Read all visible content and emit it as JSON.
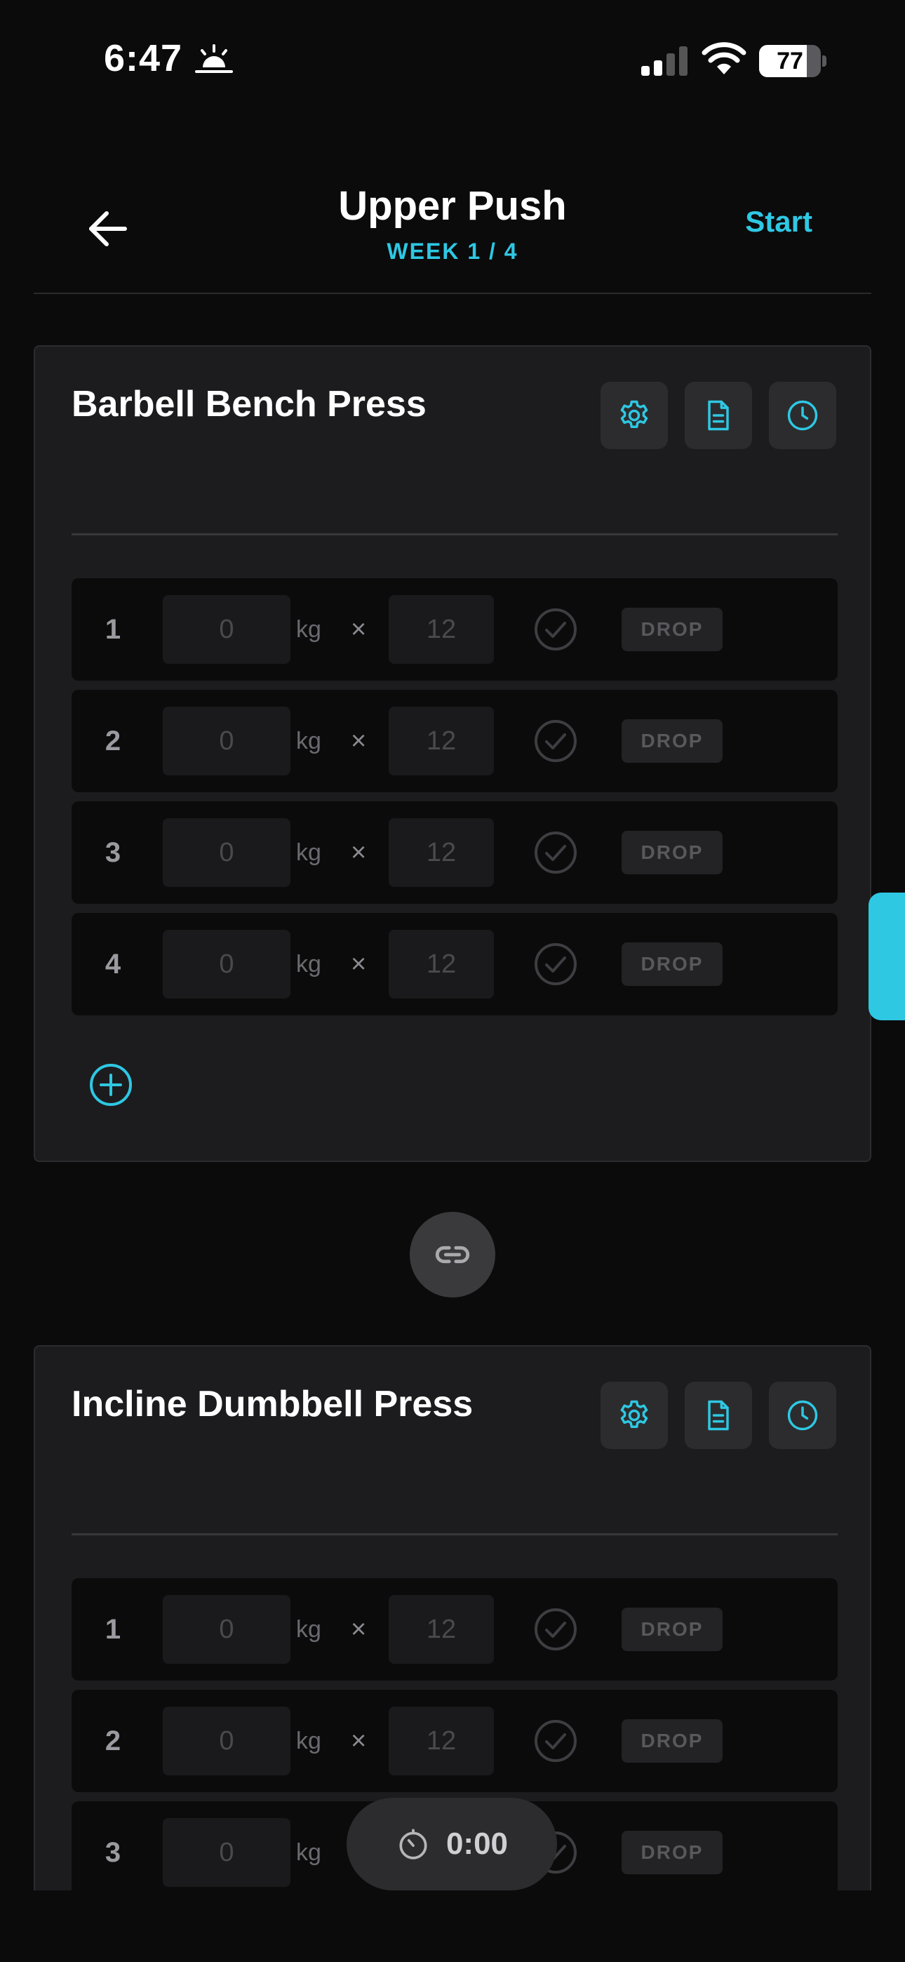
{
  "status_bar": {
    "time": "6:47",
    "battery_level": "77",
    "battery_fraction": 0.77
  },
  "header": {
    "title": "Upper Push",
    "subtitle": "WEEK 1 / 4",
    "start_label": "Start"
  },
  "exercises": [
    {
      "name": "Barbell Bench Press",
      "sets": [
        {
          "number": "1",
          "weight_placeholder": "0",
          "unit": "kg",
          "times": "×",
          "reps_placeholder": "12",
          "drop_label": "DROP"
        },
        {
          "number": "2",
          "weight_placeholder": "0",
          "unit": "kg",
          "times": "×",
          "reps_placeholder": "12",
          "drop_label": "DROP"
        },
        {
          "number": "3",
          "weight_placeholder": "0",
          "unit": "kg",
          "times": "×",
          "reps_placeholder": "12",
          "drop_label": "DROP"
        },
        {
          "number": "4",
          "weight_placeholder": "0",
          "unit": "kg",
          "times": "×",
          "reps_placeholder": "12",
          "drop_label": "DROP"
        }
      ]
    },
    {
      "name": "Incline Dumbbell Press",
      "sets": [
        {
          "number": "1",
          "weight_placeholder": "0",
          "unit": "kg",
          "times": "×",
          "reps_placeholder": "12",
          "drop_label": "DROP"
        },
        {
          "number": "2",
          "weight_placeholder": "0",
          "unit": "kg",
          "times": "×",
          "reps_placeholder": "12",
          "drop_label": "DROP"
        },
        {
          "number": "3",
          "weight_placeholder": "0",
          "unit": "kg",
          "times": "×",
          "reps_placeholder": "12",
          "drop_label": "DROP"
        }
      ]
    }
  ],
  "timer": {
    "value": "0:00"
  },
  "icons": {
    "back": "arrow-left-icon",
    "settings": "gear-icon",
    "notes": "document-icon",
    "history": "clock-icon",
    "check": "check-circle-icon",
    "add": "plus-circle-icon",
    "link": "link-icon",
    "timer": "stopwatch-icon"
  },
  "colors": {
    "accent": "#2ec8e3",
    "background": "#0b0b0c",
    "card": "#1c1c1e"
  }
}
